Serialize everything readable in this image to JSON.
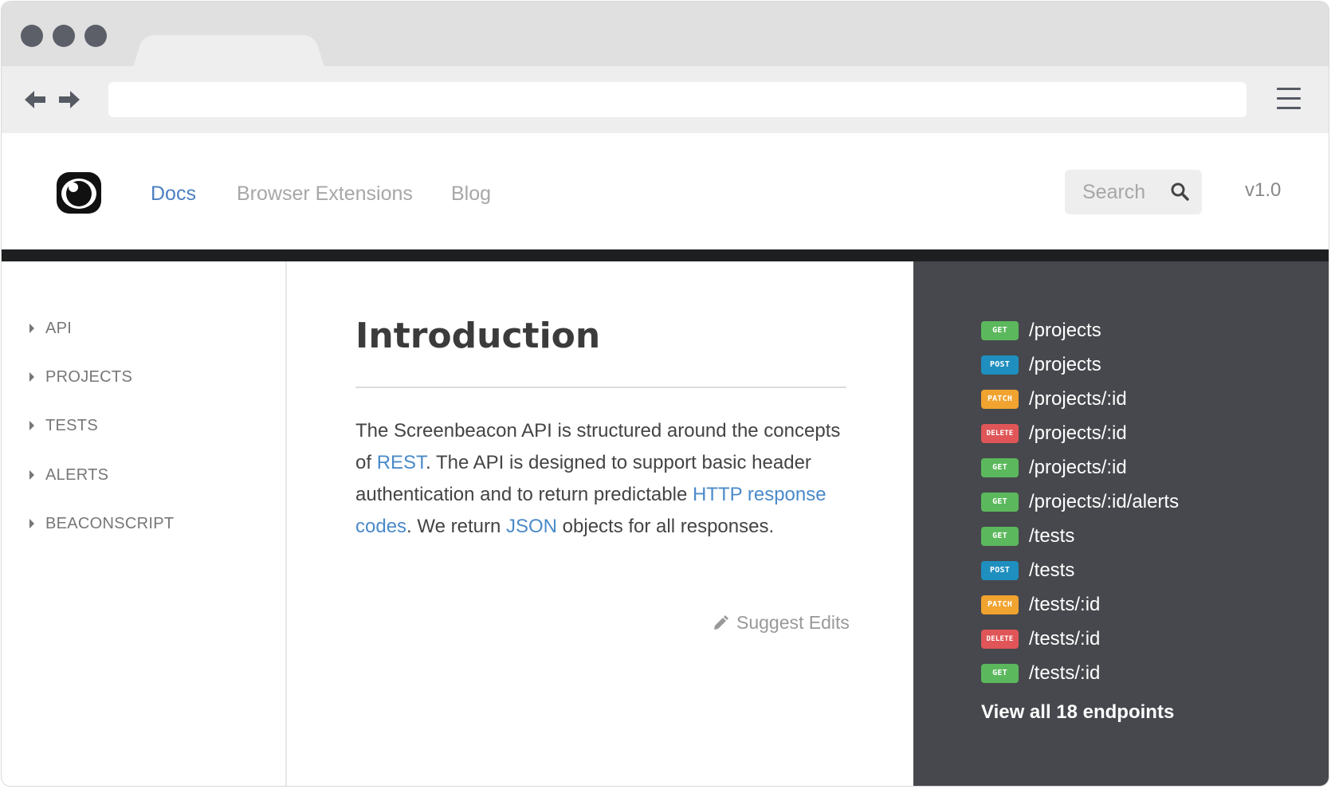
{
  "nav": {
    "links": [
      {
        "label": "Docs",
        "active": true
      },
      {
        "label": "Browser Extensions",
        "active": false
      },
      {
        "label": "Blog",
        "active": false
      }
    ],
    "search_placeholder": "Search",
    "version": "v1.0"
  },
  "sidebar": {
    "items": [
      {
        "label": "API"
      },
      {
        "label": "PROJECTS"
      },
      {
        "label": "TESTS"
      },
      {
        "label": "ALERTS"
      },
      {
        "label": "BEACONSCRIPT"
      }
    ]
  },
  "main": {
    "title": "Introduction",
    "intro": {
      "t1": "The Screenbeacon API is structured around the concepts of ",
      "link1": "REST",
      "t2": ". The API is designed to support basic header authentication and to return predictable ",
      "link2": "HTTP response codes",
      "t3": ". We return ",
      "link3": "JSON",
      "t4": " objects for all responses."
    },
    "suggest_edits": "Suggest Edits"
  },
  "endpoints": {
    "items": [
      {
        "method": "GET",
        "path": "/projects"
      },
      {
        "method": "POST",
        "path": "/projects"
      },
      {
        "method": "PATCH",
        "path": "/projects/:id"
      },
      {
        "method": "DELETE",
        "path": "/projects/:id"
      },
      {
        "method": "GET",
        "path": "/projects/:id"
      },
      {
        "method": "GET",
        "path": "/projects/:id/alerts"
      },
      {
        "method": "GET",
        "path": "/tests"
      },
      {
        "method": "POST",
        "path": "/tests"
      },
      {
        "method": "PATCH",
        "path": "/tests/:id"
      },
      {
        "method": "DELETE",
        "path": "/tests/:id"
      },
      {
        "method": "GET",
        "path": "/tests/:id"
      }
    ],
    "view_all": "View all 18 endpoints"
  },
  "colors": {
    "GET": "#5cb85c",
    "POST": "#1f8fbf",
    "PATCH": "#f0a32f",
    "DELETE": "#e05557",
    "link": "#4a8ac9",
    "active_nav": "#4a7fc0",
    "panel_bg": "#46484d"
  }
}
